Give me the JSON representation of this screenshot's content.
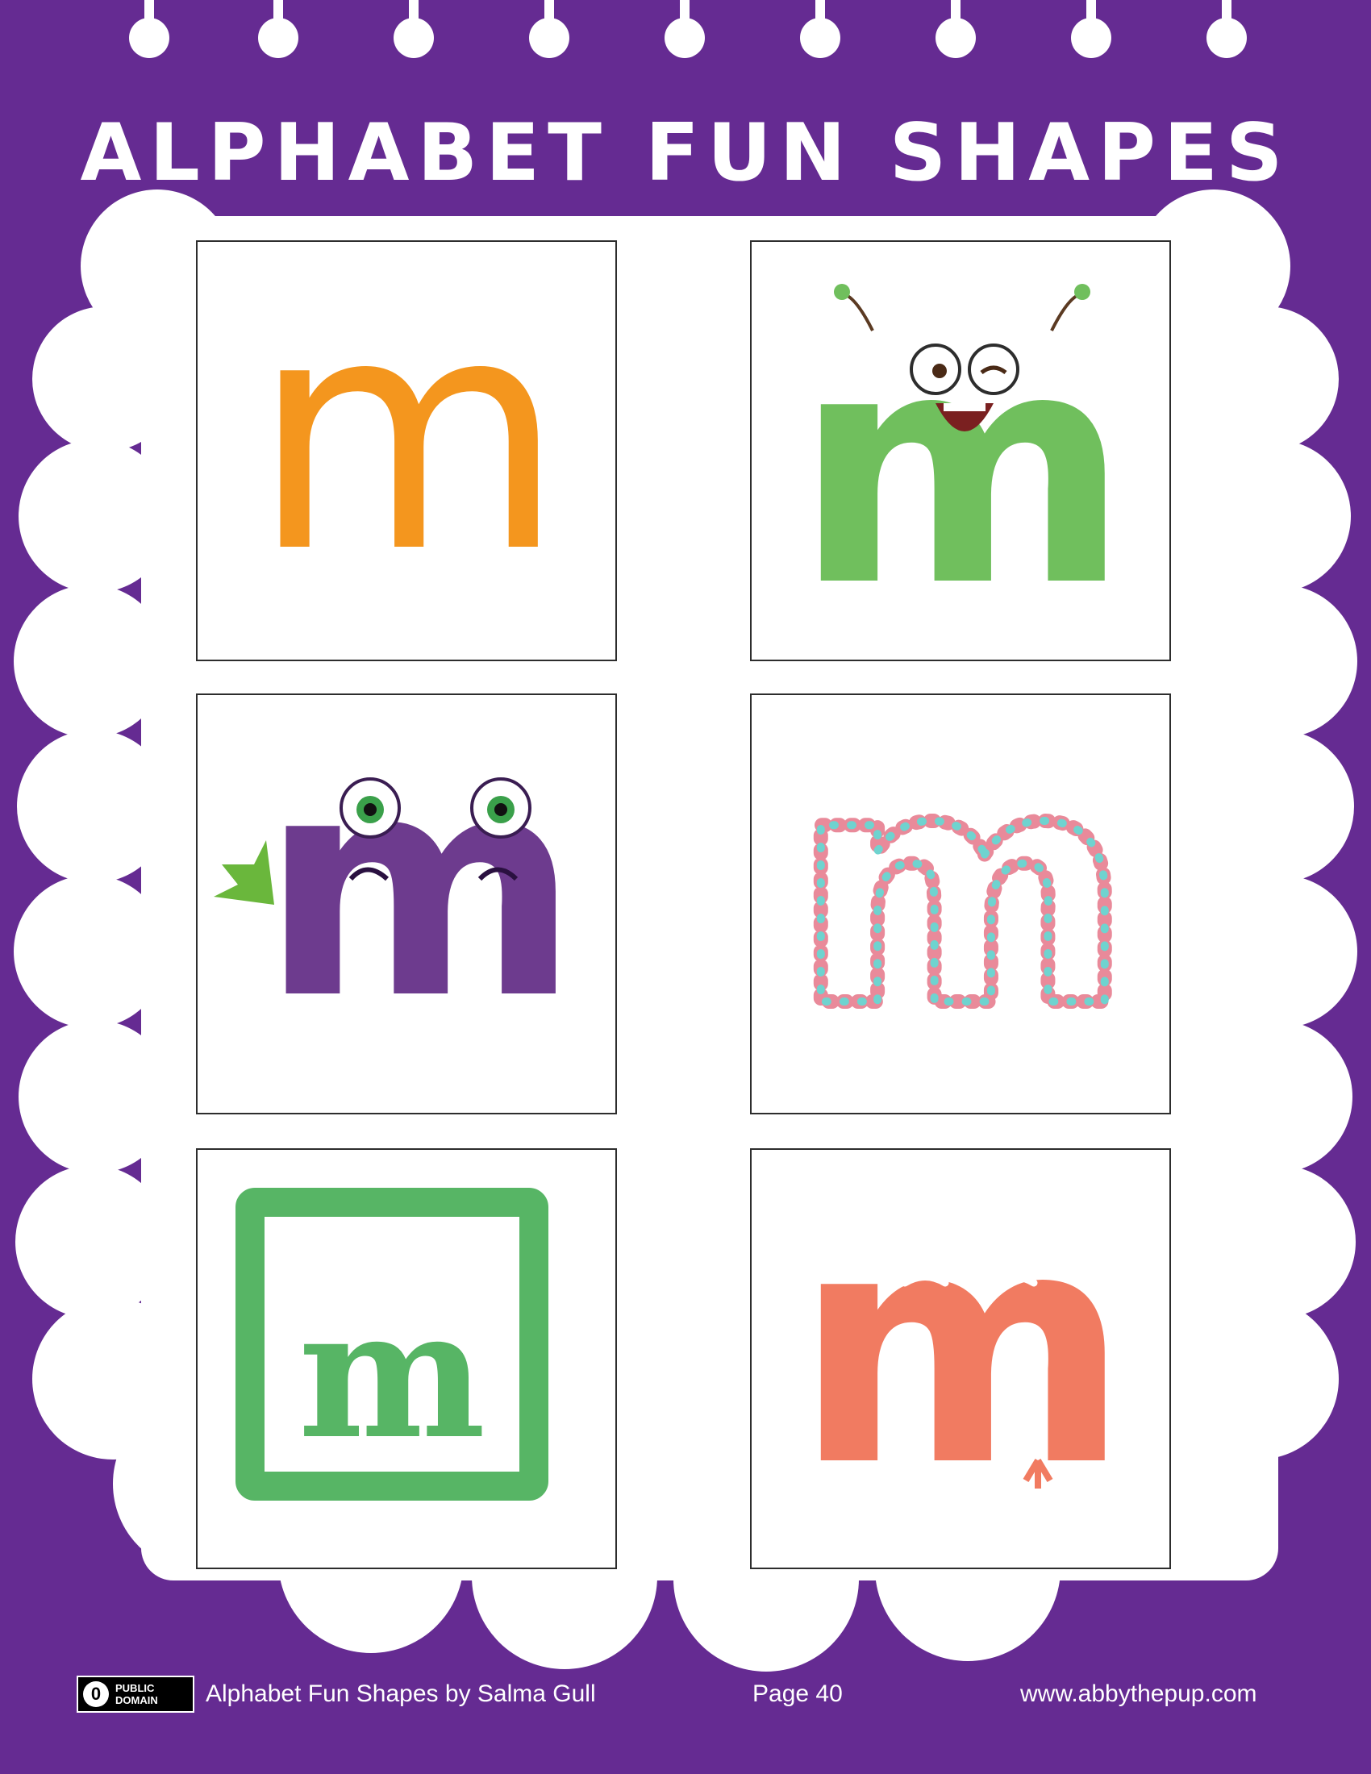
{
  "page": {
    "background": "#652b92"
  },
  "title": "ALPHABET FUN SHAPES",
  "cards": [
    {
      "name": "orange-letter-m",
      "letter": "m",
      "color": "#f4961e"
    },
    {
      "name": "green-smiling-monster-m",
      "letter": "m",
      "color": "#70bf5d"
    },
    {
      "name": "purple-bat-monster-m",
      "letter": "m",
      "color": "#6d3b8e"
    },
    {
      "name": "bubble-letter-m",
      "letter": "m",
      "color": "#e98a9a"
    },
    {
      "name": "green-framed-letter-m",
      "letter": "m",
      "color": "#57b565"
    },
    {
      "name": "balloon-letter-m",
      "letter": "m",
      "color": "#f17b61"
    }
  ],
  "footer": {
    "license_icon": "public-domain-icon",
    "license_mark": "0",
    "license_text": "PUBLIC\nDOMAIN",
    "credit": "Alphabet Fun Shapes by Salma Gull",
    "page_label": "Page 40",
    "website": "www.abbythepup.com"
  }
}
